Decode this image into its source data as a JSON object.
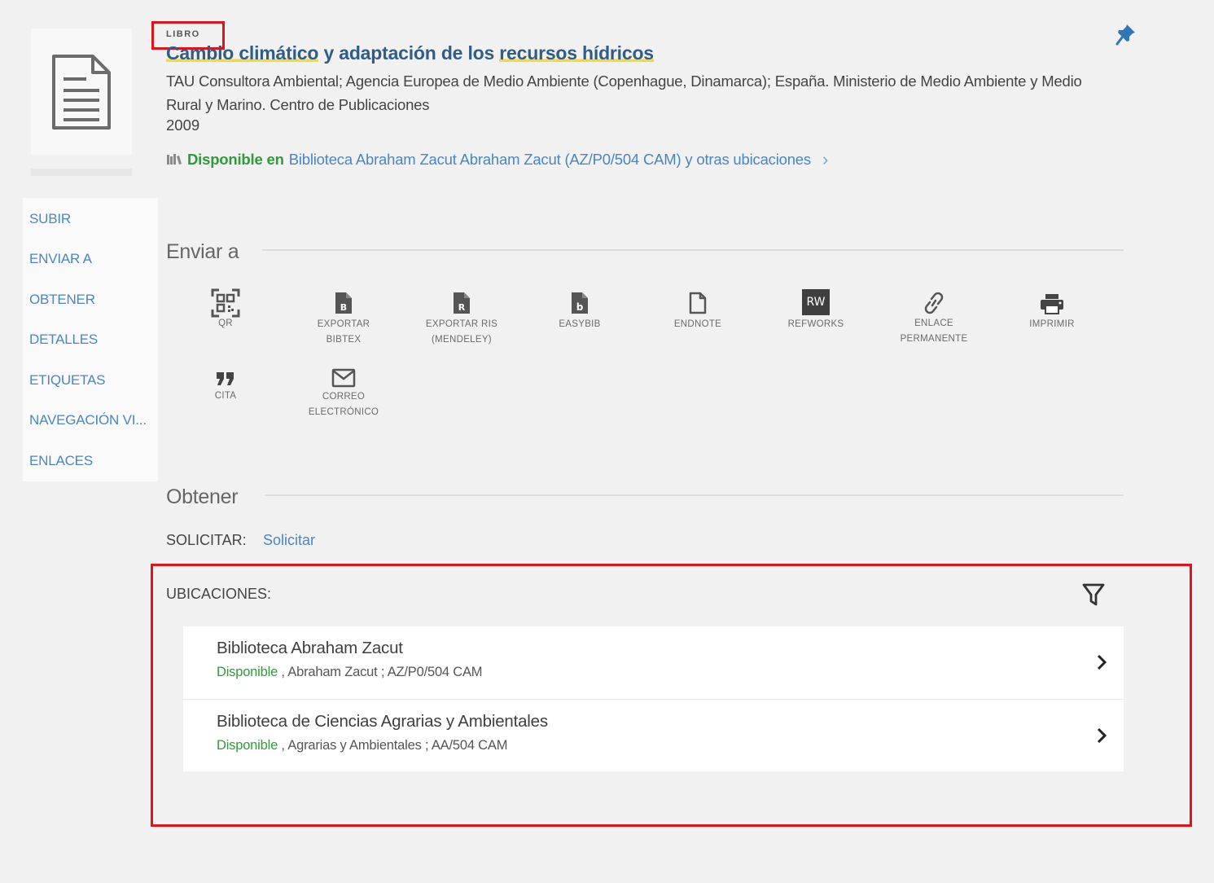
{
  "record": {
    "type_label": "LIBRO",
    "title_part1": "Cambio climático",
    "title_part2": " y adaptación de los ",
    "title_part3": "recursos hídricos",
    "authors": "TAU Consultora Ambiental; Agencia Europea de Medio Ambiente (Copenhague, Dinamarca); España. Ministerio de Medio Ambiente y Medio Rural y Marino. Centro de Publicaciones",
    "year": "2009",
    "availability_status": "Disponible en",
    "availability_location": "Biblioteca Abraham Zacut  Abraham Zacut (AZ/P0/504 CAM) y otras ubicaciones",
    "availability_chevron": "›"
  },
  "sidenav": {
    "items": [
      {
        "label": "SUBIR"
      },
      {
        "label": "ENVIAR A"
      },
      {
        "label": "OBTENER"
      },
      {
        "label": "DETALLES"
      },
      {
        "label": "ETIQUETAS"
      },
      {
        "label": "NAVEGACIÓN VI..."
      },
      {
        "label": "ENLACES"
      }
    ]
  },
  "send_to": {
    "title": "Enviar a",
    "actions": [
      {
        "line1": "QR",
        "line2": "",
        "icon": "qr-icon"
      },
      {
        "line1": "EXPORTAR",
        "line2": "BIBTEX",
        "icon": "bibtex-file-icon"
      },
      {
        "line1": "EXPORTAR RIS",
        "line2": "(MENDELEY)",
        "icon": "ris-file-icon"
      },
      {
        "line1": "EASYBIB",
        "line2": "",
        "icon": "easybib-icon"
      },
      {
        "line1": "ENDNOTE",
        "line2": "",
        "icon": "endnote-icon"
      },
      {
        "line1": "REFWORKS",
        "line2": "",
        "icon": "refworks-icon",
        "badge": "RW"
      },
      {
        "line1": "ENLACE",
        "line2": "PERMANENTE",
        "icon": "link-icon"
      },
      {
        "line1": "IMPRIMIR",
        "line2": "",
        "icon": "printer-icon"
      },
      {
        "line1": "CITA",
        "line2": "",
        "icon": "quote-icon"
      },
      {
        "line1": "CORREO",
        "line2": "ELECTRÓNICO",
        "icon": "mail-icon"
      }
    ]
  },
  "obtain": {
    "title": "Obtener",
    "request_label": "SOLICITAR:",
    "request_link": "Solicitar",
    "locations_label": "UBICACIONES:",
    "locations": [
      {
        "name": "Biblioteca Abraham Zacut",
        "status": "Disponible",
        "detail": " , Abraham Zacut ; AZ/P0/504 CAM"
      },
      {
        "name": "Biblioteca de Ciencias Agrarias y Ambientales",
        "status": "Disponible",
        "detail": " , Agrarias y Ambientales ; AA/504 CAM"
      }
    ]
  },
  "colors": {
    "title": "#2f5d8a",
    "link": "#4a86c0",
    "available": "#2f9b3b",
    "highlight_box": "#e0121b",
    "title_underline": "#f2d841"
  }
}
